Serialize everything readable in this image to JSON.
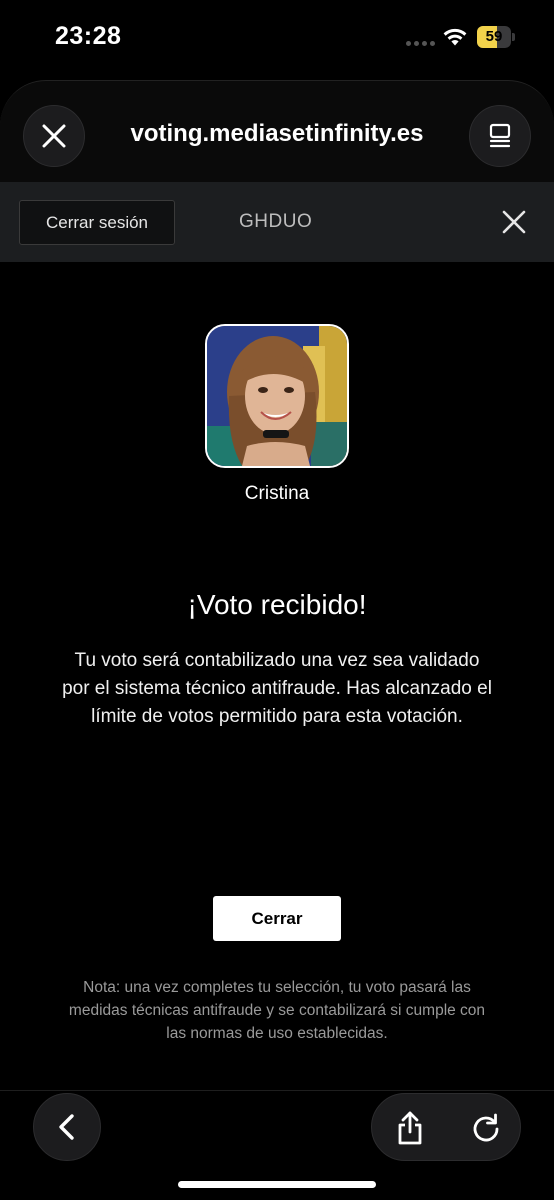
{
  "status_bar": {
    "time": "23:28",
    "battery_level": "59",
    "battery_fraction": 0.59,
    "battery_color": "#f2d24b"
  },
  "browser": {
    "url": "voting.mediasetinfinity.es",
    "close_icon": "close-icon",
    "menu_icon": "reader-menu-icon"
  },
  "session": {
    "logout_label": "Cerrar sesión",
    "username": "GHDUO",
    "close_icon": "close-icon"
  },
  "contestant": {
    "name": "Cristina"
  },
  "vote": {
    "title": "¡Voto recibido!",
    "message": "Tu voto será contabilizado una vez sea validado por el sistema técnico antifraude. Has alcanzado el límite de votos permitido para esta votación.",
    "close_label": "Cerrar"
  },
  "note": "Nota: una vez completes tu selección, tu voto pasará las medidas técnicas antifraude y se contabilizará si cumple con las normas de uso establecidas.",
  "toolbar": {
    "back_icon": "chevron-left-icon",
    "share_icon": "share-icon",
    "reload_icon": "reload-icon"
  }
}
